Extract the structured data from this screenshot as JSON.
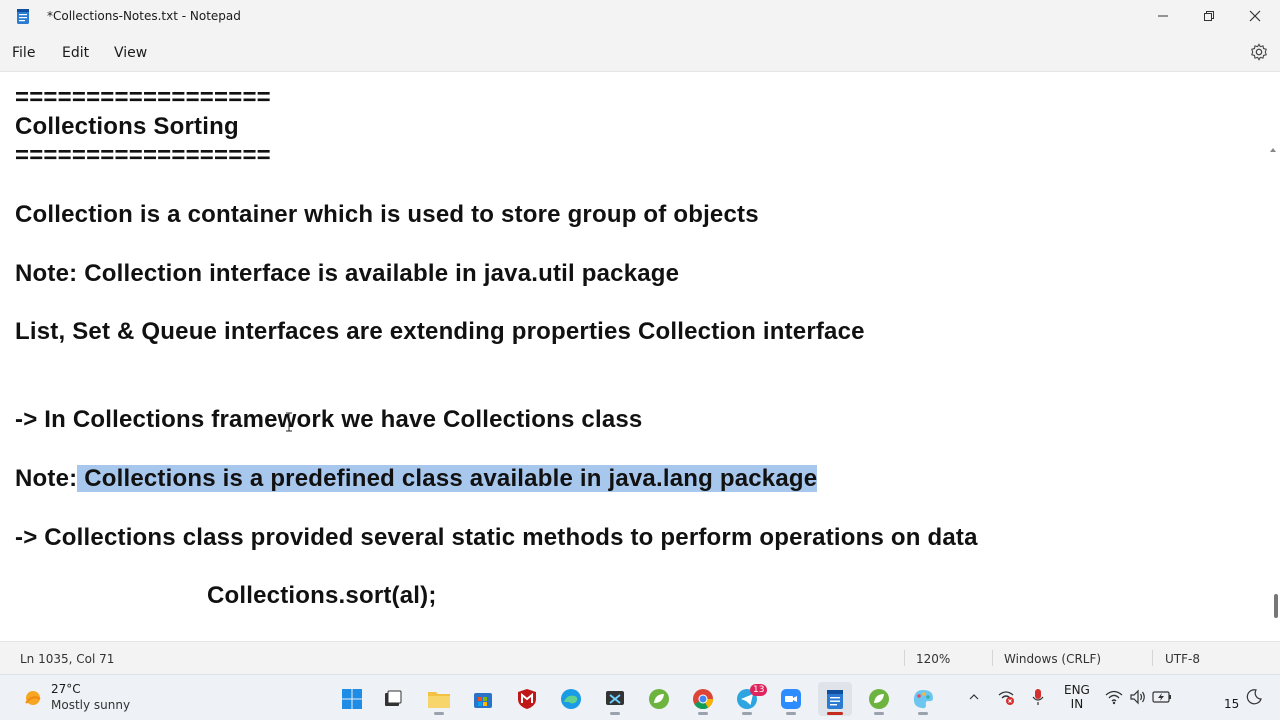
{
  "window": {
    "title": "*Collections-Notes.txt - Notepad"
  },
  "menu": {
    "file": "File",
    "edit": "Edit",
    "view": "View"
  },
  "editor": {
    "lines": [
      "==================",
      "Collections Sorting",
      "==================",
      "Collection is a container which is used to store group of objects",
      "Note: Collection interface is available in java.util package",
      "List, Set & Queue interfaces are extending properties Collection interface",
      "-> In Collections framework we have Collections class",
      "-> Collections class provided several static methods to perform operations on data",
      "Collections.sort(al);"
    ],
    "note_line": {
      "prefix": "Note:",
      "space": " ",
      "selected": "Collections is a predefined class available in java.lang package"
    }
  },
  "status": {
    "position": "Ln 1035, Col 71",
    "zoom": "120%",
    "line_ending": "Windows (CRLF)",
    "encoding": "UTF-8"
  },
  "taskbar": {
    "weather_temp": "27°C",
    "weather_desc": "Mostly sunny",
    "telegram_badge": "13",
    "lang_line1": "ENG",
    "lang_line2": "IN",
    "clock": "15"
  },
  "colors": {
    "selection": "#a8c7ec",
    "chrome_bg": "#f3f3f3",
    "taskbar_bg": "#eef1f5"
  }
}
